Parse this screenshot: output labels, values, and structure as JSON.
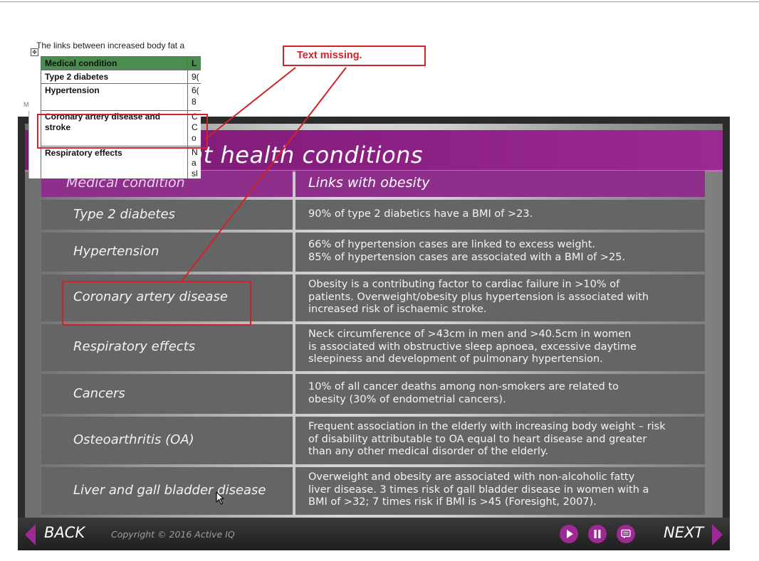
{
  "slide": {
    "title": "nt health conditions",
    "table_header": {
      "condition": "Medical condition",
      "links": "Links with obesity"
    },
    "rows": [
      {
        "condition": "Type 2 diabetes",
        "links": "90% of type 2 diabetics have a BMI of >23."
      },
      {
        "condition": "Hypertension",
        "links": "66% of hypertension cases are linked to excess weight.\n85% of hypertension cases are associated with a BMI of >25."
      },
      {
        "condition": "Coronary artery disease",
        "links": "Obesity is a contributing factor to cardiac failure in >10% of\npatients. Overweight/obesity plus hypertension is associated with\nincreased risk of ischaemic stroke."
      },
      {
        "condition": "Respiratory effects",
        "links": "Neck circumference of >43cm in men and >40.5cm in women\nis associated with obstructive sleep apnoea, excessive daytime\nsleepiness and development of pulmonary hypertension."
      },
      {
        "condition": "Cancers",
        "links": "10% of all cancer deaths among non-smokers are related to\nobesity (30% of endometrial cancers)."
      },
      {
        "condition": "Osteoarthritis (OA)",
        "links": "Frequent association in the elderly with increasing body weight – risk\nof disability attributable to OA equal to heart disease and greater\nthan any other medical disorder of the elderly."
      },
      {
        "condition": "Liver and gall bladder disease",
        "links": "Overweight and obesity are associated with non-alcoholic fatty\nliver disease. 3 times risk of gall bladder disease in women with a\nBMI of >32; 7 times risk if BMI is >45 (Foresight, 2007)."
      }
    ]
  },
  "nav": {
    "back_label": "BACK",
    "next_label": "NEXT",
    "copyright": "Copyright © 2016 Active IQ",
    "controls": [
      "play-icon",
      "pause-icon",
      "transcript-icon"
    ],
    "accent_color": "#9d2a95"
  },
  "doc_snippet": {
    "caption": "The links between increased body fat a",
    "anchor_glyph": "✥",
    "margin_letter": "M",
    "header": {
      "col1": "Medical condition",
      "col2": "L"
    },
    "rows": [
      {
        "col1": "Type 2 diabetes",
        "col2": "9("
      },
      {
        "col1": "Hypertension",
        "col2": "6(\n8"
      },
      {
        "col1": "Coronary artery disease and stroke",
        "col2": "C\nC\no"
      },
      {
        "col1": "Respiratory effects",
        "col2": "N\na\nsl"
      }
    ]
  },
  "annotation": {
    "callout_text": "Text missing.",
    "color": "#d1222a"
  }
}
